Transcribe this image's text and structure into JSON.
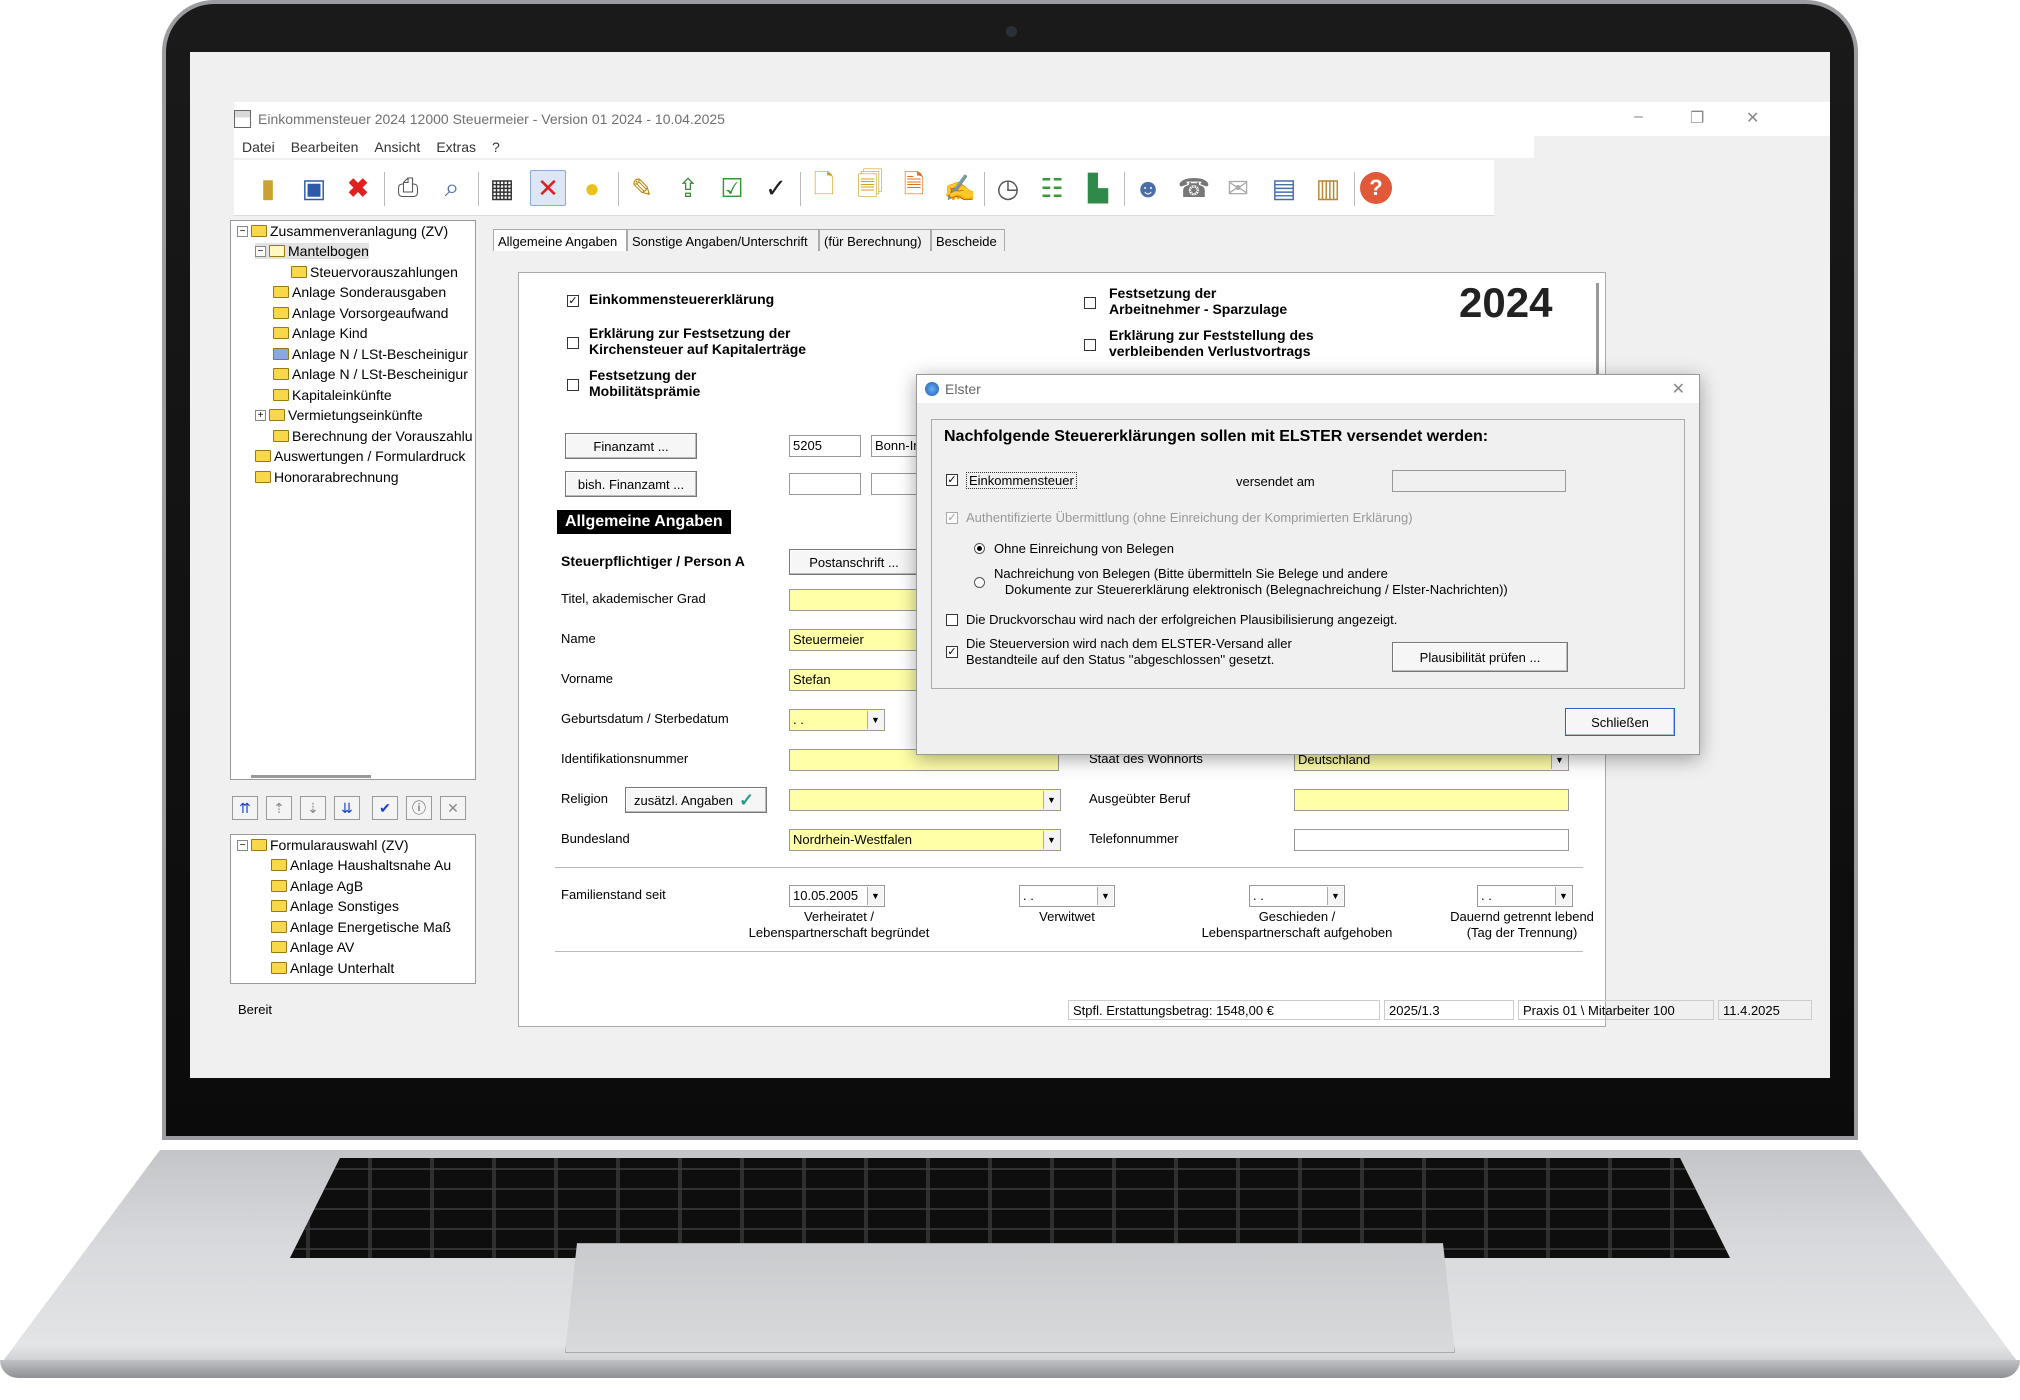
{
  "window": {
    "title": "Einkommensteuer 2024 12000 Steuermeier - Version 01 2024 - 10.04.2025",
    "minimize": "–",
    "restore": "❐",
    "close": "✕"
  },
  "menu": [
    "Datei",
    "Bearbeiten",
    "Ansicht",
    "Extras",
    "?"
  ],
  "toolbar": [
    "book-icon",
    "save-icon",
    "delete-icon",
    "print-icon",
    "preview-icon",
    "calculator-icon",
    "cancel-calc-icon",
    "lightbulb-icon",
    "stamp-icon",
    "export-icon",
    "check-icon",
    "elster-icon",
    "document-icon",
    "document-copy-icon",
    "document-pdf-icon",
    "edit-icon",
    "timer-icon",
    "abacus-icon",
    "chart-icon",
    "users-icon",
    "fax-icon",
    "mail-icon",
    "table-icon",
    "archive-icon",
    "help-icon"
  ],
  "tree": {
    "items": [
      "Zusammenveranlagung (ZV)",
      "Mantelbogen",
      "Steuervorauszahlungen",
      "Anlage Sonderausgaben",
      "Anlage Vorsorgeaufwand",
      "Anlage Kind",
      "Anlage N / LSt-Bescheinigur",
      "Anlage N / LSt-Bescheinigur",
      "Kapitaleinkünfte",
      "Vermietungseinkünfte",
      "Berechnung der Vorauszahlu",
      "Auswertungen / Formulardruck",
      "Honorarabrechnung"
    ]
  },
  "formular": {
    "items": [
      "Formularauswahl (ZV)",
      "Anlage Haushaltsnahe Au",
      "Anlage AgB",
      "Anlage Sonstiges",
      "Anlage Energetische Maß",
      "Anlage AV",
      "Anlage Unterhalt"
    ]
  },
  "tabs": [
    "Allgemeine Angaben",
    "Sonstige Angaben/Unterschrift",
    "(für Berechnung)",
    "Bescheide"
  ],
  "form": {
    "year": "2024",
    "cb_est": "Einkommensteuererklärung",
    "cb_kirche_1": "Erklärung zur Festsetzung der",
    "cb_kirche_2": "Kirchensteuer auf Kapitalerträge",
    "cb_mob_1": "Festsetzung der",
    "cb_mob_2": "Mobilitätsprämie",
    "cb_arbn_1": "Festsetzung der",
    "cb_arbn_2": "Arbeitnehmer - Sparzulage",
    "cb_verl_1": "Erklärung zur Feststellung des",
    "cb_verl_2": "verbleibenden Verlustvortrags",
    "finanzamt_btn": "Finanzamt  ...",
    "finanzamt_nr": "5205",
    "finanzamt_name": "Bonn-Innenstadt",
    "bish_btn": "bish. Finanzamt  ...",
    "section": "Allgemeine Angaben",
    "person": "Steuerpflichtiger / Person A",
    "postanschrift": "Postanschrift  ...",
    "titel_label": "Titel, akademischer Grad",
    "name_label": "Name",
    "name_value": "Steuermeier",
    "vorname_label": "Vorname",
    "vorname_value": "Stefan",
    "geb_label": "Geburtsdatum / Sterbedatum",
    "geb_value": " .  .",
    "id_label": "Identifikationsnummer",
    "wohnort_label": "Staat des Wohnorts",
    "wohnort_value": "Deutschland",
    "religion_label": "Religion",
    "zusatz_btn": "zusätzl. Angaben",
    "beruf_label": "Ausgeübter Beruf",
    "bundesland_label": "Bundesland",
    "bundesland_value": "Nordrhein-Westfalen",
    "telefon_label": "Telefonnummer",
    "fam_label": "Familienstand seit",
    "fam_date": "10.05.2005",
    "empty_date": " .  .",
    "verh_1": "Verheiratet /",
    "verh_2": "Lebenspartnerschaft begründet",
    "verwitwet": "Verwitwet",
    "gesch_1": "Geschieden /",
    "gesch_2": "Lebenspartnerschaft aufgehoben",
    "getr_1": "Dauernd getrennt lebend",
    "getr_2": "(Tag der Trennung)"
  },
  "dialog": {
    "title": "Elster",
    "heading": "Nachfolgende Steuererklärungen sollen mit ELSTER versendet werden:",
    "cb_est": "Einkommensteuer",
    "versendet": "versendet am",
    "auth": "Authentifizierte Übermittlung (ohne Einreichung der Komprimierten Erklärung)",
    "radio1": "Ohne Einreichung von Belegen",
    "radio2_1": "Nachreichung von Belegen (Bitte übermitteln Sie Belege und andere",
    "radio2_2": "Dokumente zur Steuererklärung elektronisch (Belegnachreichung / Elster-Nachrichten))",
    "druck": "Die Druckvorschau wird nach der erfolgreichen Plausibilisierung angezeigt.",
    "status_1": "Die Steuerversion wird nach dem ELSTER-Versand aller",
    "status_2": "Bestandteile auf den Status ''abgeschlossen'' gesetzt.",
    "plaus_btn": "Plausibilität prüfen ...",
    "close_btn": "Schließen"
  },
  "status": {
    "ready": "Bereit",
    "erstattung": "Stpfl. Erstattungsbetrag: 1548,00  €",
    "version": "2025/1.3",
    "praxis": "Praxis 01 \\ Mitarbeiter 100",
    "date": "11.4.2025"
  }
}
